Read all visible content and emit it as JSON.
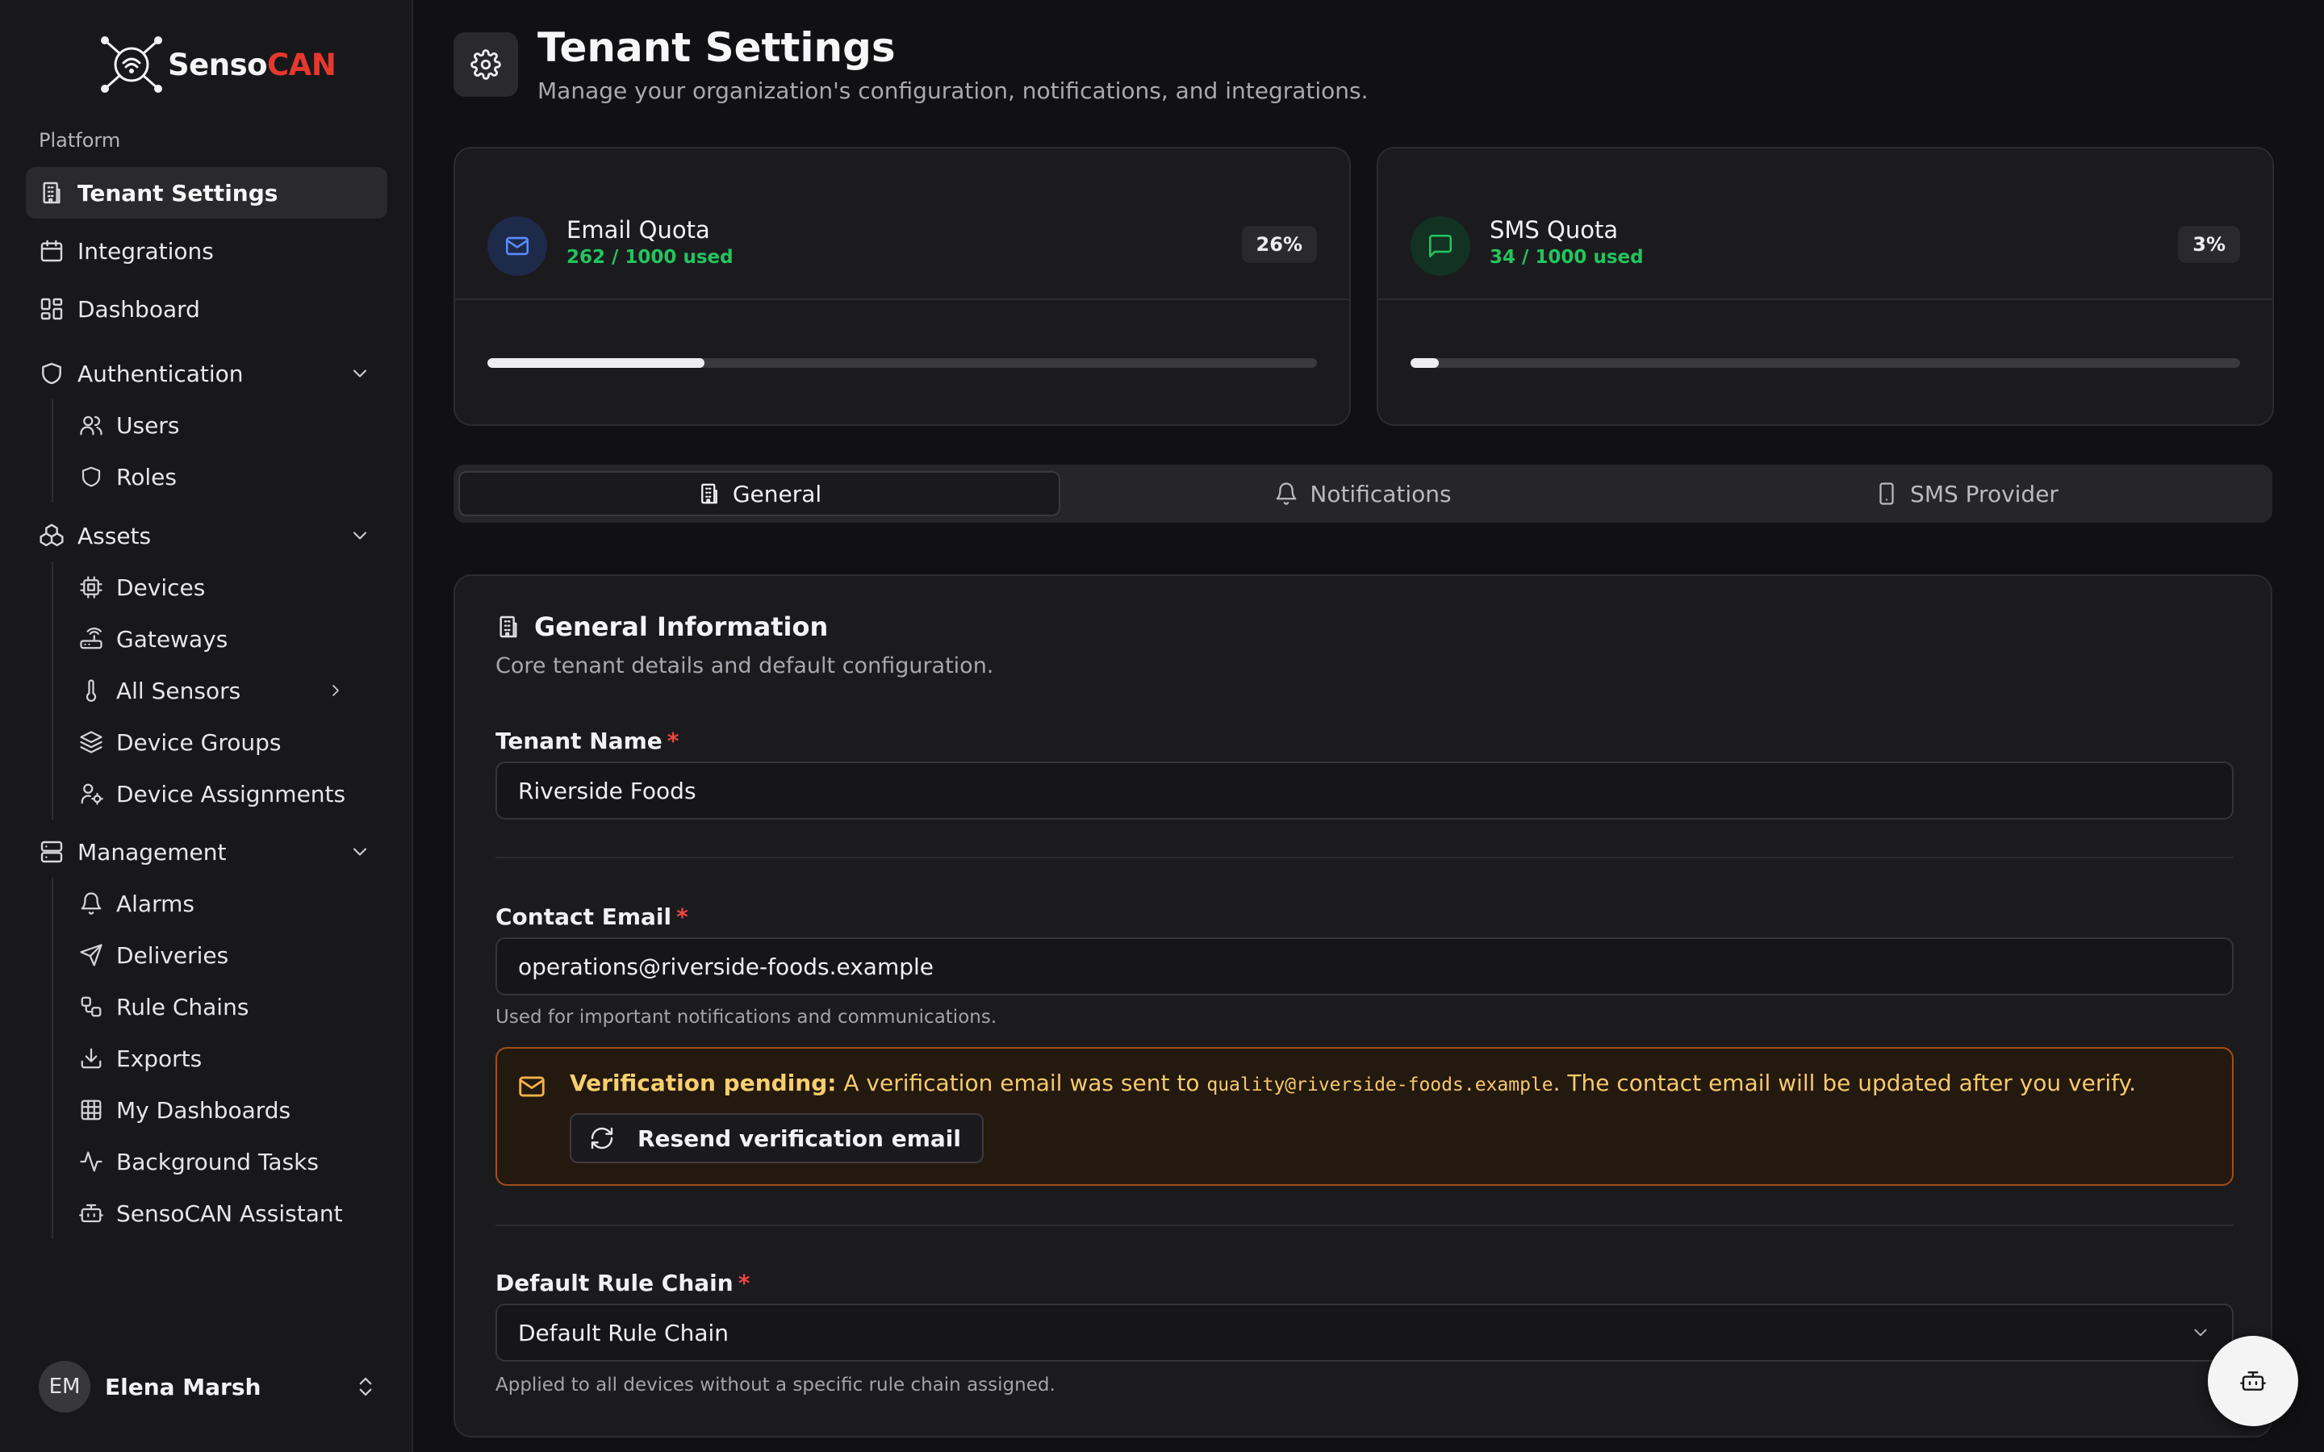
{
  "brand": {
    "name_part1": "Senso",
    "name_part2": "CAN",
    "accent": "#e5382f"
  },
  "sidebar": {
    "group_label": "Platform",
    "top_items": [
      {
        "label": "Tenant Settings",
        "icon": "building-icon",
        "active": true
      },
      {
        "label": "Integrations",
        "icon": "calendar-icon"
      },
      {
        "label": "Dashboard",
        "icon": "grid-icon"
      }
    ],
    "authentication": {
      "label": "Authentication",
      "icon": "shield-icon",
      "items": [
        {
          "label": "Users",
          "icon": "users-icon"
        },
        {
          "label": "Roles",
          "icon": "shield-icon"
        }
      ]
    },
    "assets": {
      "label": "Assets",
      "icon": "boxes-icon",
      "items": [
        {
          "label": "Devices",
          "icon": "cpu-icon"
        },
        {
          "label": "Gateways",
          "icon": "router-icon"
        },
        {
          "label": "All Sensors",
          "icon": "thermometer-icon"
        },
        {
          "label": "Device Groups",
          "icon": "layers-icon"
        },
        {
          "label": "Device Assignments",
          "icon": "user-cog-icon"
        }
      ]
    },
    "management": {
      "label": "Management",
      "icon": "server-icon",
      "items": [
        {
          "label": "Alarms",
          "icon": "bell-icon"
        },
        {
          "label": "Deliveries",
          "icon": "send-icon"
        },
        {
          "label": "Rule Chains",
          "icon": "workflow-icon"
        },
        {
          "label": "Exports",
          "icon": "download-icon"
        },
        {
          "label": "My Dashboards",
          "icon": "table-icon"
        },
        {
          "label": "Background Tasks",
          "icon": "activity-icon"
        },
        {
          "label": "SensoCAN Assistant",
          "icon": "bot-icon"
        }
      ]
    },
    "user": {
      "initials": "EM",
      "name": "Elena Marsh"
    }
  },
  "header": {
    "title": "Tenant Settings",
    "subtitle": "Manage your organization's configuration, notifications, and integrations."
  },
  "quotas": {
    "email": {
      "title": "Email Quota",
      "used": "262 / 1000 used",
      "percent_label": "26%",
      "fraction": 0.262,
      "color": "#3b82f6"
    },
    "sms": {
      "title": "SMS Quota",
      "used": "34 / 1000 used",
      "percent_label": "3%",
      "fraction": 0.034,
      "color": "#22c55e"
    }
  },
  "tabs": [
    {
      "label": "General",
      "icon": "building-icon",
      "active": true
    },
    {
      "label": "Notifications",
      "icon": "bell-icon"
    },
    {
      "label": "SMS Provider",
      "icon": "smartphone-icon"
    }
  ],
  "general": {
    "title": "General Information",
    "subtitle": "Core tenant details and default configuration.",
    "tenant_name": {
      "label": "Tenant Name",
      "value": "Riverside Foods"
    },
    "contact_email": {
      "label": "Contact Email",
      "value": "operations@riverside-foods.example",
      "help": "Used for important notifications and communications."
    },
    "verification": {
      "heading": "Verification pending:",
      "text_before": " A verification email was sent to ",
      "email": "quality@riverside-foods.example",
      "text_after": ". The contact email will be updated after you verify.",
      "button": "Resend verification email"
    },
    "rule_chain": {
      "label": "Default Rule Chain",
      "value": "Default Rule Chain",
      "help": "Applied to all devices without a specific rule chain assigned."
    }
  },
  "required_marker": "*"
}
